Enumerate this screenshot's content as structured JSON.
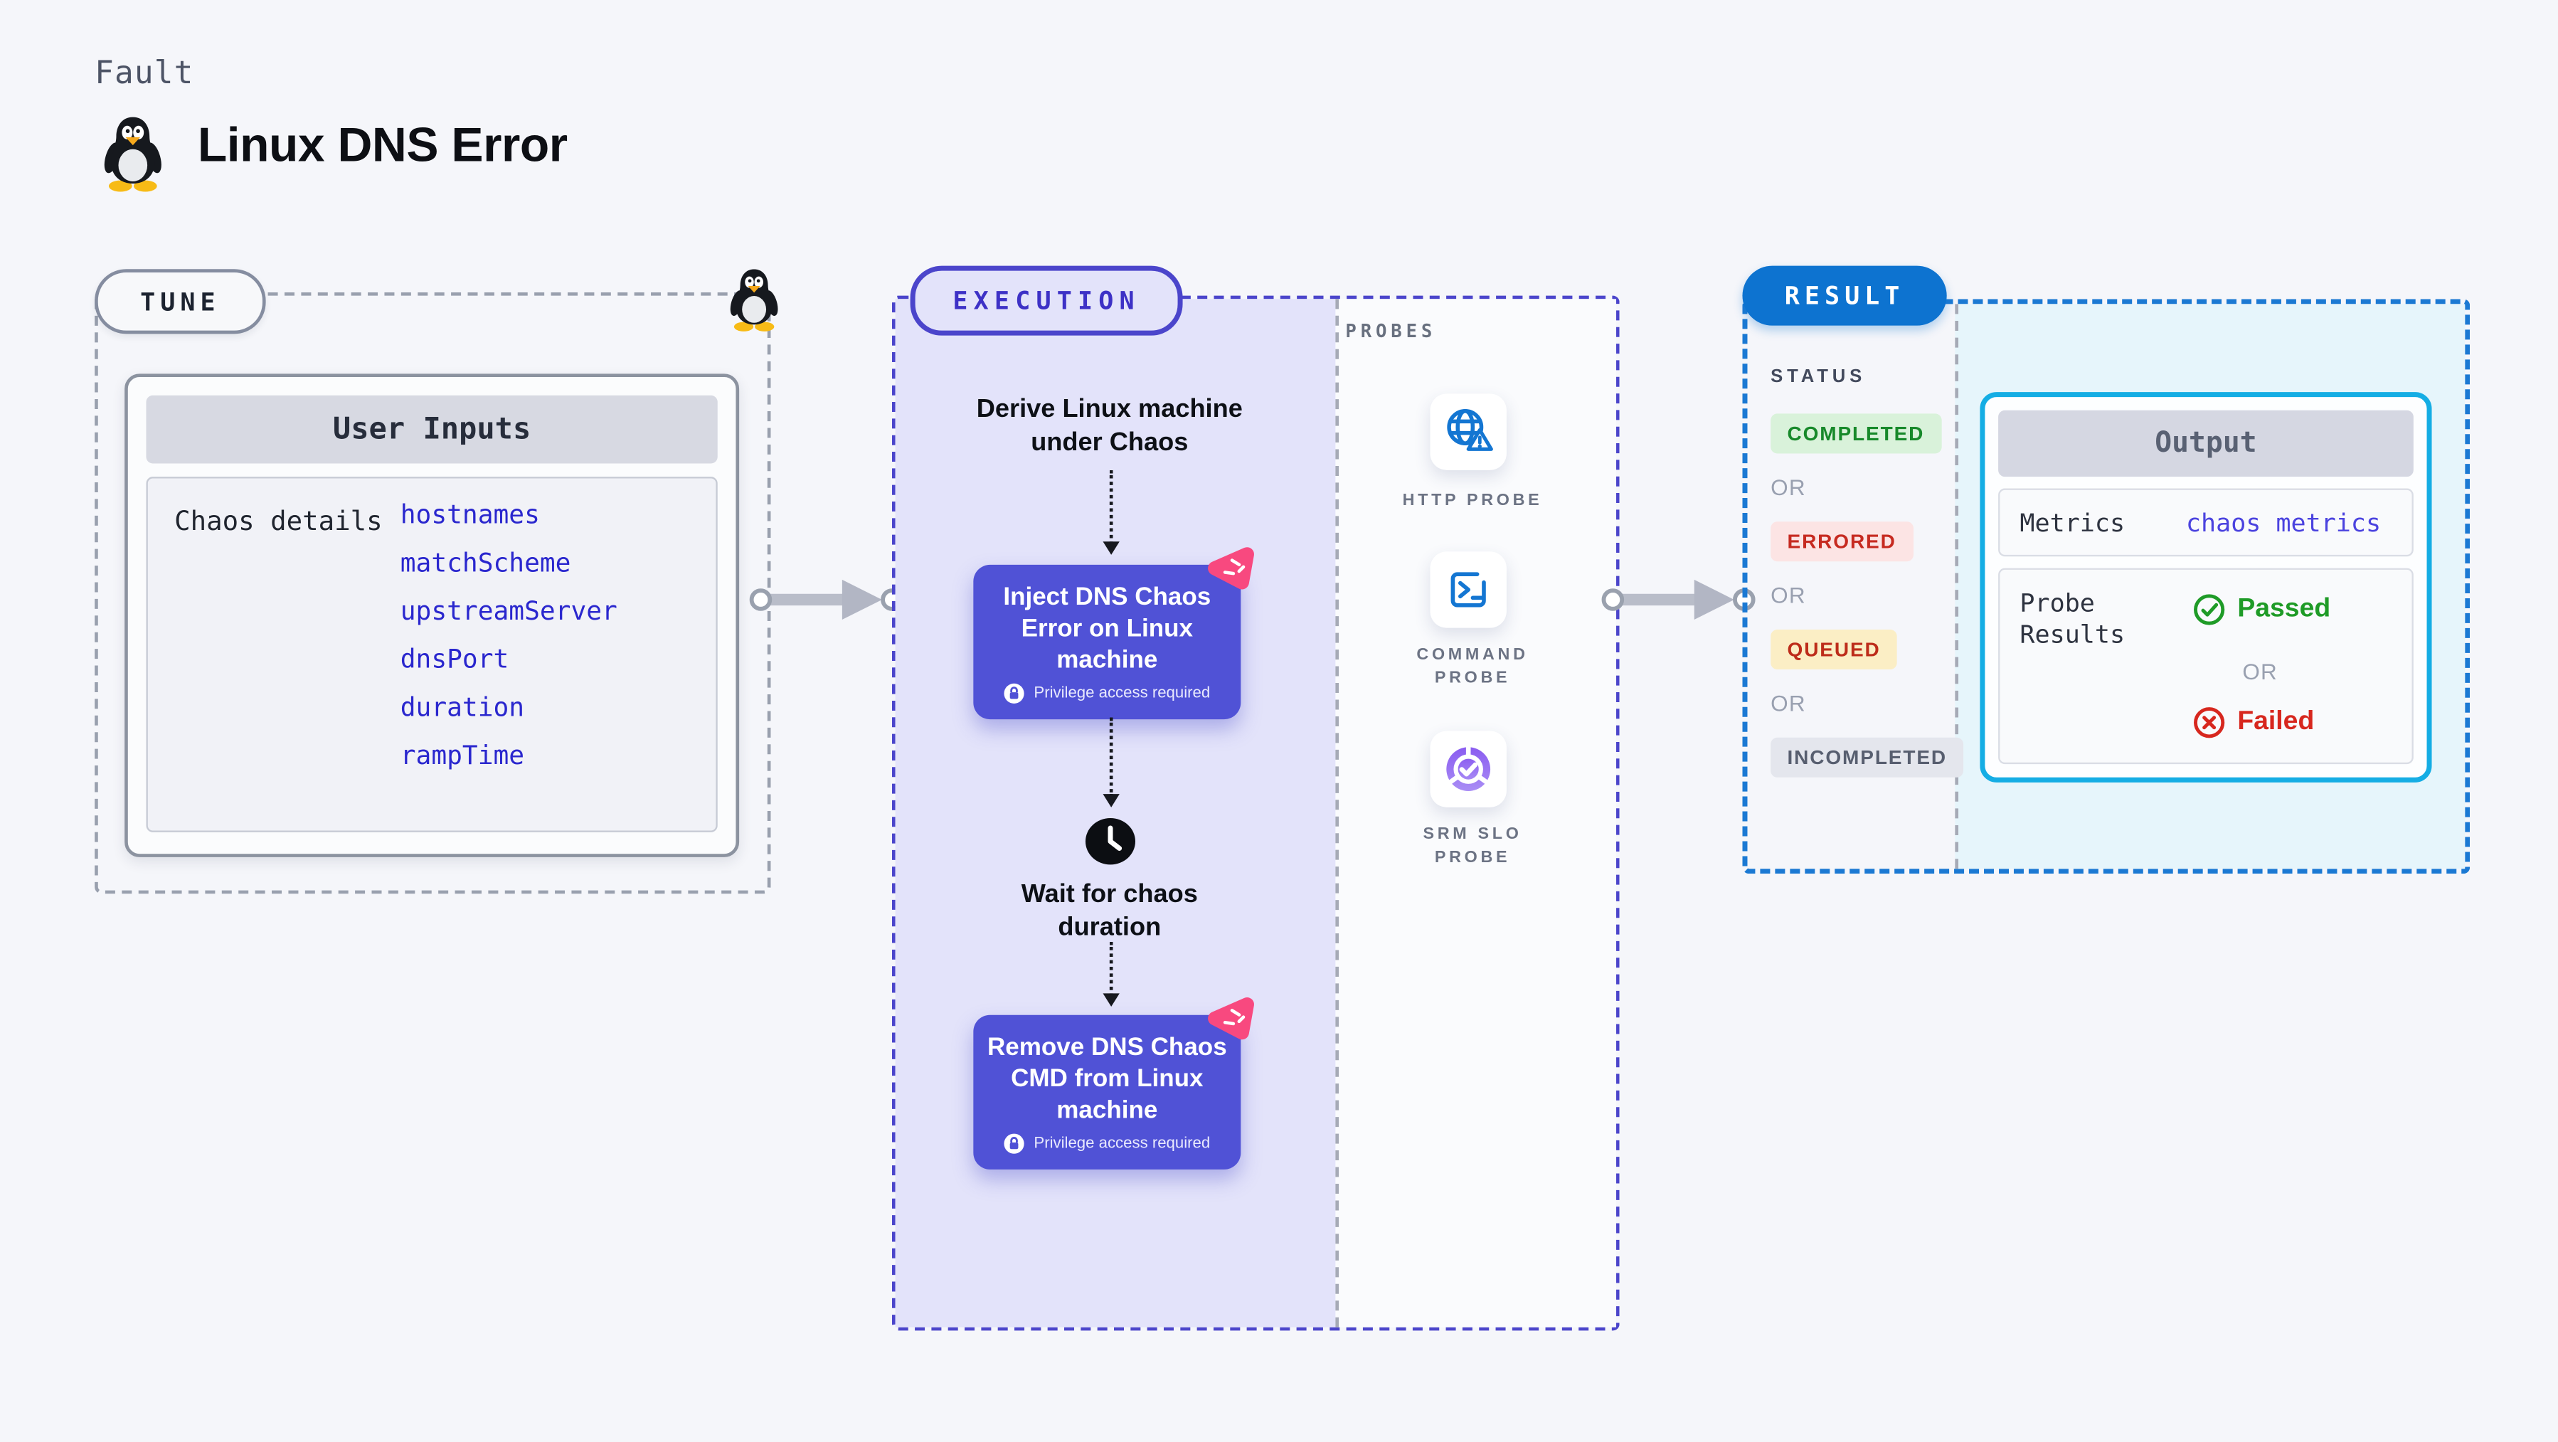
{
  "header": {
    "category": "Fault",
    "title": "Linux DNS Error"
  },
  "tune": {
    "label": "TUNE",
    "user_inputs_title": "User Inputs",
    "row_label": "Chaos details",
    "params": [
      "hostnames",
      "matchScheme",
      "upstreamServer",
      "dnsPort",
      "duration",
      "rampTime"
    ]
  },
  "execution": {
    "label": "EXECUTION",
    "derive_step": "Derive Linux machine under Chaos",
    "inject": {
      "title": "Inject DNS Chaos Error on Linux machine",
      "badge": "Privilege access required"
    },
    "wait_step": "Wait for chaos duration",
    "remove": {
      "title": "Remove DNS Chaos CMD from Linux machine",
      "badge": "Privilege access required"
    }
  },
  "probes": {
    "label": "PROBES",
    "items": [
      {
        "icon": "globe-warning-icon",
        "lines": [
          "HTTP PROBE"
        ]
      },
      {
        "icon": "terminal-icon",
        "lines": [
          "COMMAND",
          "PROBE"
        ]
      },
      {
        "icon": "donut-check-icon",
        "lines": [
          "SRM SLO",
          "PROBE"
        ]
      }
    ]
  },
  "result": {
    "label": "RESULT",
    "status_label": "STATUS",
    "or_text": "OR",
    "statuses": [
      {
        "text": "COMPLETED",
        "kind": "green"
      },
      {
        "text": "ERRORED",
        "kind": "red"
      },
      {
        "text": "QUEUED",
        "kind": "amber"
      },
      {
        "text": "INCOMPLETED",
        "kind": "gray"
      }
    ],
    "output": {
      "title": "Output",
      "metrics_label": "Metrics",
      "metrics_value": "chaos metrics",
      "probe_label": "Probe Results",
      "passed": "Passed",
      "failed": "Failed"
    }
  },
  "colors": {
    "page_bg": "#f5f6fa",
    "execution_accent": "#4b45cb",
    "execution_fill": "#e3e3fa",
    "node_indigo": "#5052d6",
    "chaos_pink": "#f8497f",
    "result_accent": "#0d73d0",
    "result_dash": "#1b79d3",
    "output_border": "#15ade4",
    "result_fill": "#e6f5fb",
    "passed_green": "#1f9b27",
    "failed_red": "#d7271e",
    "param_blue": "#2a27ce",
    "probe_icon_blue": "#1476d2",
    "srm_purple": "#8a5cf0"
  }
}
